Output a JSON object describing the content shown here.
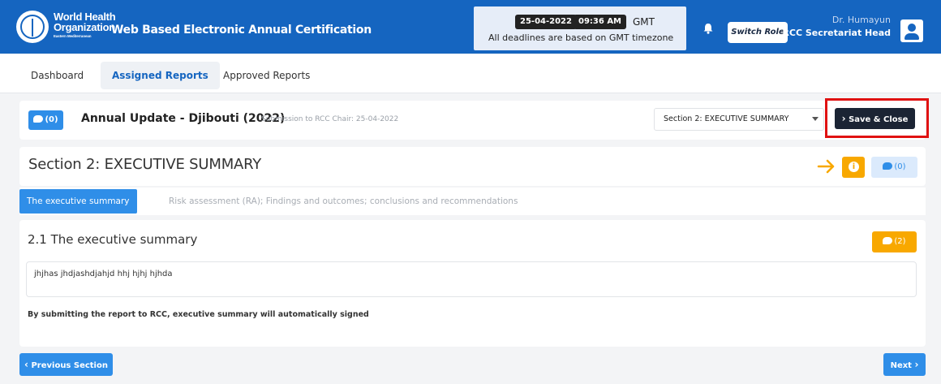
{
  "header": {
    "org_name_line1": "World Health",
    "org_name_line2": "Organization",
    "org_sub": "Eastern Mediterranean",
    "app_title": "Web Based Electronic Annual Certification",
    "date": "25-04-2022",
    "time": "09:36 AM",
    "timezone": "GMT",
    "deadline_note": "All deadlines are based on GMT timezone",
    "switch_role_label": "Switch Role",
    "user_name": "Dr. Humayun",
    "user_role": "RCC Secretariat Head"
  },
  "nav": {
    "tabs": [
      {
        "label": "Dashboard",
        "active": false
      },
      {
        "label": "Assigned Reports",
        "active": true
      },
      {
        "label": "Approved Reports",
        "active": false
      }
    ]
  },
  "report": {
    "comment_count": "(0)",
    "title": "Annual Update - Djibouti (2022)",
    "submission": "Submission to RCC Chair: 25-04-2022",
    "section_select_value": "Section 2: EXECUTIVE SUMMARY",
    "save_close_label": "Save & Close"
  },
  "section": {
    "title": "Section 2: EXECUTIVE SUMMARY",
    "comment_count": "(0)"
  },
  "subtabs": [
    {
      "label": "The executive summary",
      "active": true
    },
    {
      "label": "Risk assessment (RA); Findings and outcomes; conclusions and recommendations",
      "active": false
    }
  ],
  "content": {
    "heading": "2.1 The executive summary",
    "comment_count": "(2)",
    "summary_text": "jhjhas jhdjashdjahjd hhj hjhj hjhda",
    "sign_note": "By submitting the report to RCC, executive summary will automatically signed"
  },
  "footer": {
    "prev_label": "Previous Section",
    "next_label": "Next"
  },
  "colors": {
    "header_bg": "#1565c0",
    "primary": "#2f8ee8",
    "accent_orange": "#f8a800",
    "dark_button": "#1b2434",
    "highlight_red": "#e01212"
  }
}
